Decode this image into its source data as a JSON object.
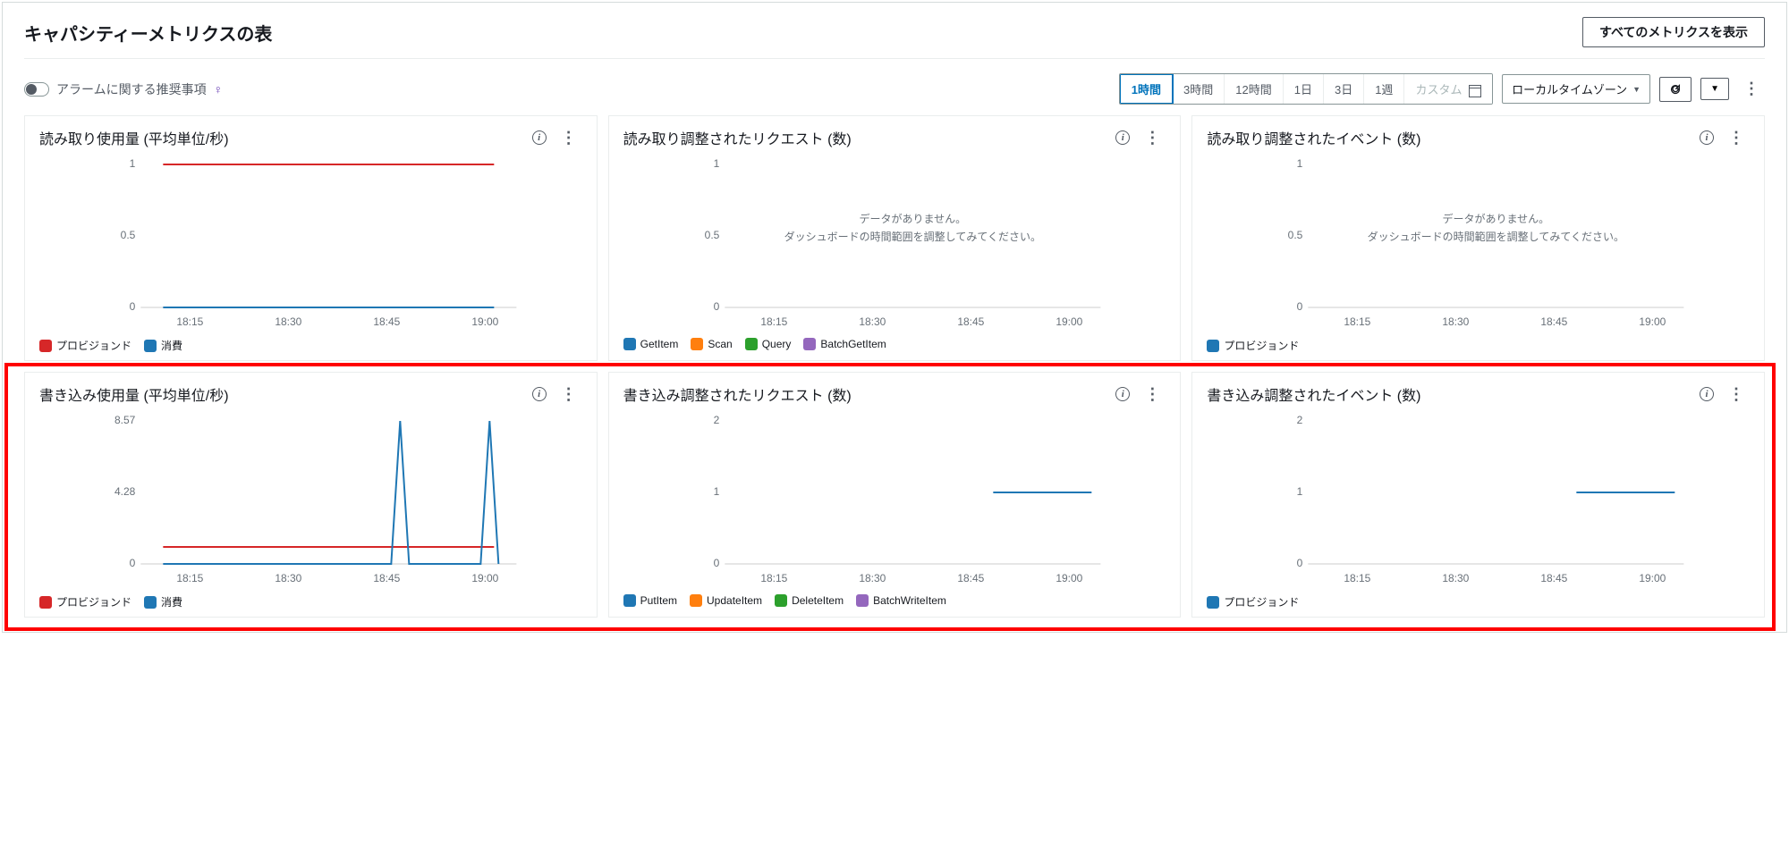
{
  "header": {
    "title": "キャパシティーメトリクスの表",
    "view_all_button": "すべてのメトリクスを表示"
  },
  "toolbar": {
    "alarm_recommendations": "アラームに関する推奨事項",
    "ranges": [
      "1時間",
      "3時間",
      "12時間",
      "1日",
      "3日",
      "1週"
    ],
    "active_range_index": 0,
    "custom_label": "カスタム",
    "timezone_label": "ローカルタイムゾーン"
  },
  "noData": {
    "line1": "データがありません。",
    "line2": "ダッシュボードの時間範囲を調整してみてください。"
  },
  "cards": [
    {
      "title": "読み取り使用量 (平均単位/秒)"
    },
    {
      "title": "読み取り調整されたリクエスト (数)"
    },
    {
      "title": "読み取り調整されたイベント (数)"
    },
    {
      "title": "書き込み使用量 (平均単位/秒)"
    },
    {
      "title": "書き込み調整されたリクエスト (数)"
    },
    {
      "title": "書き込み調整されたイベント (数)"
    }
  ],
  "legend_labels": {
    "provisioned": "プロビジョンド",
    "consumed": "消費",
    "GetItem": "GetItem",
    "Scan": "Scan",
    "Query": "Query",
    "BatchGetItem": "BatchGetItem",
    "PutItem": "PutItem",
    "UpdateItem": "UpdateItem",
    "DeleteItem": "DeleteItem",
    "BatchWriteItem": "BatchWriteItem"
  },
  "colors": {
    "blue": "#1f77b4",
    "orange": "#ff7f0e",
    "green": "#2ca02c",
    "purple": "#9467bd",
    "red": "#d62728"
  },
  "chart_data": [
    {
      "id": "read_usage",
      "type": "line",
      "x_ticks": [
        "18:15",
        "18:30",
        "18:45",
        "19:00"
      ],
      "y_ticks": [
        0,
        0.5,
        1
      ],
      "ylim": [
        0,
        1
      ],
      "series": [
        {
          "name": "プロビジョンド",
          "color": "#d62728",
          "values": [
            1,
            1,
            1,
            1,
            1,
            1,
            1,
            1,
            1,
            1,
            1,
            1
          ]
        },
        {
          "name": "消費",
          "color": "#1f77b4",
          "values": [
            0,
            0,
            0,
            0,
            0,
            0,
            0,
            0,
            0,
            0,
            0,
            0
          ]
        }
      ]
    },
    {
      "id": "read_throttled_requests",
      "type": "line",
      "x_ticks": [
        "18:15",
        "18:30",
        "18:45",
        "19:00"
      ],
      "y_ticks": [
        0,
        0.5,
        1
      ],
      "ylim": [
        0,
        1
      ],
      "no_data": true,
      "series": [
        {
          "name": "GetItem",
          "color": "#1f77b4"
        },
        {
          "name": "Scan",
          "color": "#ff7f0e"
        },
        {
          "name": "Query",
          "color": "#2ca02c"
        },
        {
          "name": "BatchGetItem",
          "color": "#9467bd"
        }
      ]
    },
    {
      "id": "read_throttled_events",
      "type": "line",
      "x_ticks": [
        "18:15",
        "18:30",
        "18:45",
        "19:00"
      ],
      "y_ticks": [
        0,
        0.5,
        1
      ],
      "ylim": [
        0,
        1
      ],
      "no_data": true,
      "series": [
        {
          "name": "プロビジョンド",
          "color": "#1f77b4"
        }
      ]
    },
    {
      "id": "write_usage",
      "type": "line",
      "x_ticks": [
        "18:15",
        "18:30",
        "18:45",
        "19:00"
      ],
      "y_ticks": [
        0,
        4.28,
        8.57
      ],
      "ylim": [
        0,
        8.57
      ],
      "series": [
        {
          "name": "プロビジョンド",
          "color": "#d62728",
          "values": [
            1,
            1,
            1,
            1,
            1,
            1,
            1,
            1,
            1,
            1,
            1,
            1
          ]
        },
        {
          "name": "消費",
          "color": "#1f77b4",
          "values": [
            0,
            0,
            0,
            0,
            0,
            0,
            0,
            8.57,
            0,
            0,
            0,
            8.57,
            0
          ]
        }
      ]
    },
    {
      "id": "write_throttled_requests",
      "type": "line",
      "x_ticks": [
        "18:15",
        "18:30",
        "18:45",
        "19:00"
      ],
      "y_ticks": [
        0,
        1,
        2
      ],
      "ylim": [
        0,
        2
      ],
      "series": [
        {
          "name": "PutItem",
          "color": "#1f77b4",
          "x_start": "18:50",
          "x_end": "19:05",
          "values": [
            1,
            1,
            1,
            1
          ]
        },
        {
          "name": "UpdateItem",
          "color": "#ff7f0e"
        },
        {
          "name": "DeleteItem",
          "color": "#2ca02c"
        },
        {
          "name": "BatchWriteItem",
          "color": "#9467bd"
        }
      ]
    },
    {
      "id": "write_throttled_events",
      "type": "line",
      "x_ticks": [
        "18:15",
        "18:30",
        "18:45",
        "19:00"
      ],
      "y_ticks": [
        0,
        1,
        2
      ],
      "ylim": [
        0,
        2
      ],
      "series": [
        {
          "name": "プロビジョンド",
          "color": "#1f77b4",
          "x_start": "18:50",
          "x_end": "19:05",
          "values": [
            1,
            1,
            1,
            1
          ]
        }
      ]
    }
  ]
}
